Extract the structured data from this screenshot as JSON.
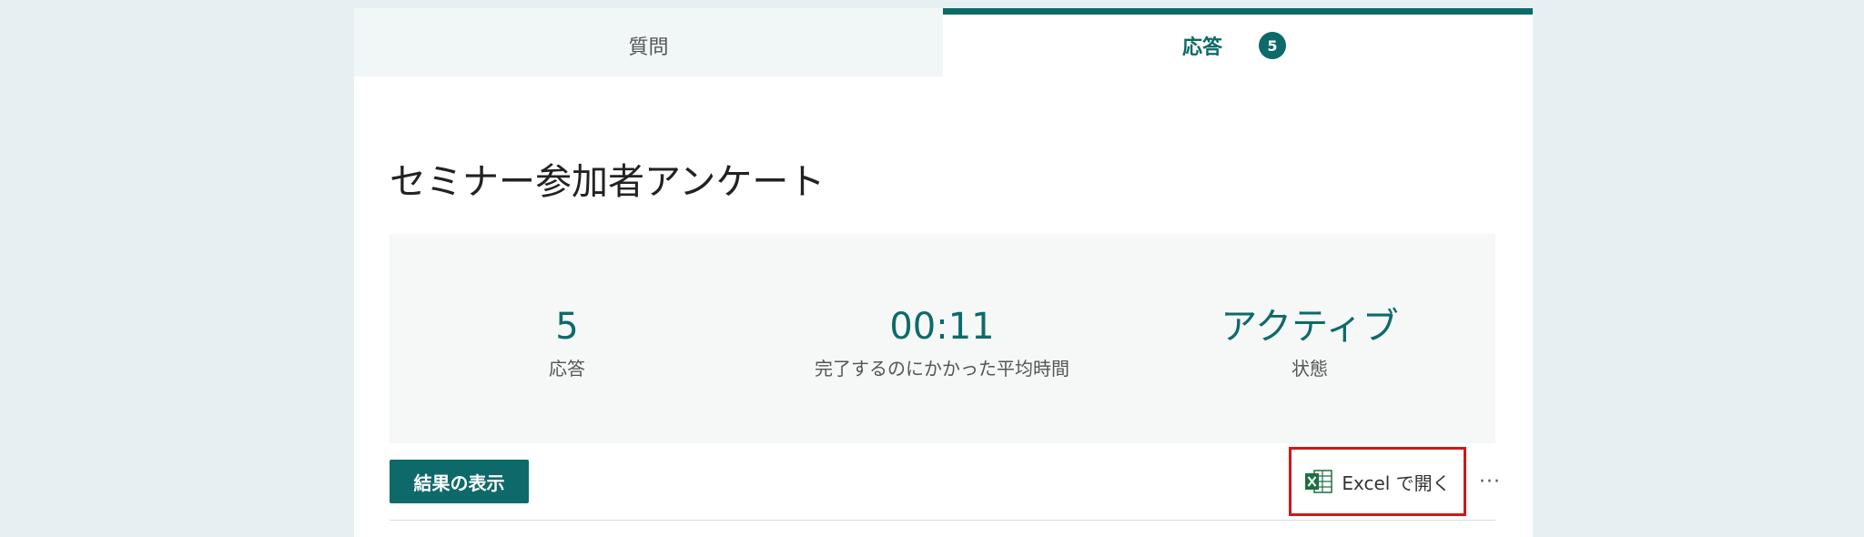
{
  "tabs": {
    "questions_label": "質問",
    "responses_label": "応答",
    "responses_count": "5"
  },
  "form": {
    "title": "セミナー参加者アンケート"
  },
  "summary": {
    "responses": {
      "value": "5",
      "label": "応答"
    },
    "avg_time": {
      "value": "00:11",
      "label": "完了するのにかかった平均時間"
    },
    "status": {
      "value": "アクティブ",
      "label": "状態"
    }
  },
  "actions": {
    "view_results_label": "結果の表示",
    "open_excel_label": "Excel で開く",
    "more_label": "···"
  },
  "colors": {
    "accent": "#0e6a6a",
    "highlight": "#d0171a",
    "excel_green": "#1d6f42"
  },
  "icons": {
    "excel": "excel-icon"
  }
}
